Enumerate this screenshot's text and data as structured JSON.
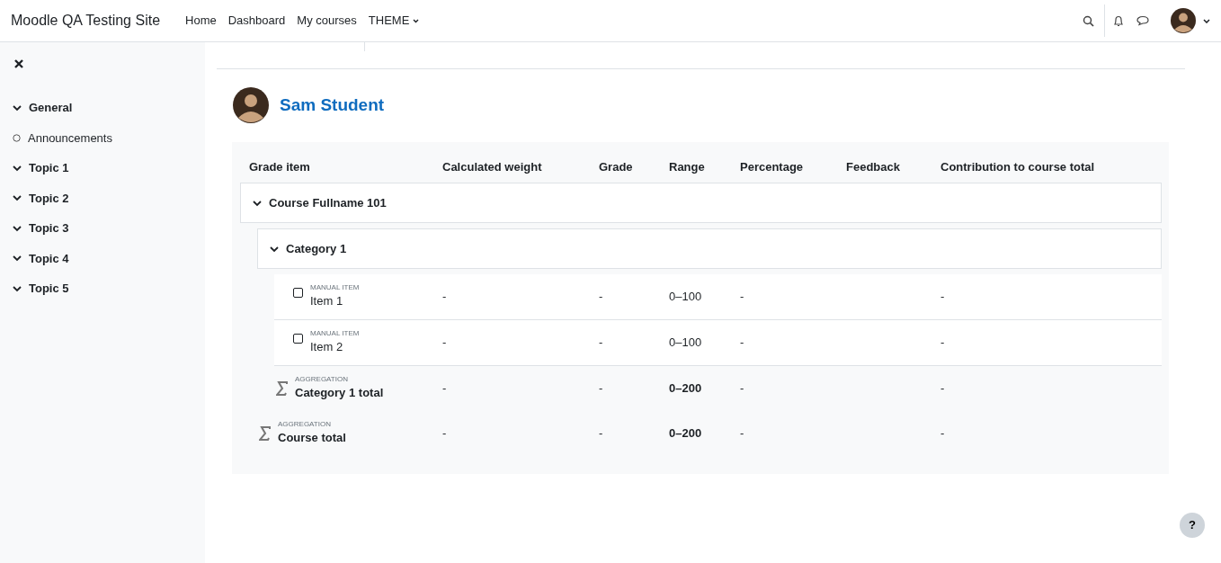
{
  "navbar": {
    "site_name": "Moodle QA Testing Site",
    "links": [
      {
        "label": "Home",
        "dropdown": false
      },
      {
        "label": "Dashboard",
        "dropdown": false
      },
      {
        "label": "My courses",
        "dropdown": false
      },
      {
        "label": "THEME",
        "dropdown": true
      }
    ]
  },
  "sidebar": {
    "items": [
      {
        "label": "General",
        "kind": "section",
        "expanded": true
      },
      {
        "label": "Announcements",
        "kind": "activity"
      },
      {
        "label": "Topic 1",
        "kind": "section",
        "expanded": true
      },
      {
        "label": "Topic 2",
        "kind": "section",
        "expanded": true
      },
      {
        "label": "Topic 3",
        "kind": "section",
        "expanded": true
      },
      {
        "label": "Topic 4",
        "kind": "section",
        "expanded": true
      },
      {
        "label": "Topic 5",
        "kind": "section",
        "expanded": true
      }
    ]
  },
  "user": {
    "name": "Sam Student"
  },
  "grade_table": {
    "columns": [
      "Grade item",
      "Calculated weight",
      "Grade",
      "Range",
      "Percentage",
      "Feedback",
      "Contribution to course total"
    ],
    "rows": [
      {
        "kind": "category",
        "name": "Course Fullname 101",
        "expanded": true,
        "children": [
          {
            "kind": "category",
            "name": "Category 1",
            "expanded": true,
            "children": [
              {
                "kind": "item",
                "type_label": "MANUAL ITEM",
                "name": "Item 1",
                "checked": false,
                "weight": "-",
                "grade": "-",
                "range": "0–100",
                "percentage": "-",
                "contribution": "-"
              },
              {
                "kind": "item",
                "type_label": "MANUAL ITEM",
                "name": "Item 2",
                "checked": false,
                "weight": "-",
                "grade": "-",
                "range": "0–100",
                "percentage": "-",
                "contribution": "-"
              },
              {
                "kind": "total",
                "type_label": "AGGREGATION",
                "name": "Category 1 total",
                "weight": "-",
                "grade": "-",
                "range": "0–200",
                "percentage": "-",
                "contribution": "-"
              }
            ]
          },
          {
            "kind": "total",
            "type_label": "AGGREGATION",
            "name": "Course total",
            "weight": "-",
            "grade": "-",
            "range": "0–200",
            "percentage": "-",
            "contribution": "-"
          }
        ]
      }
    ]
  },
  "help_button": {
    "label": "?"
  }
}
